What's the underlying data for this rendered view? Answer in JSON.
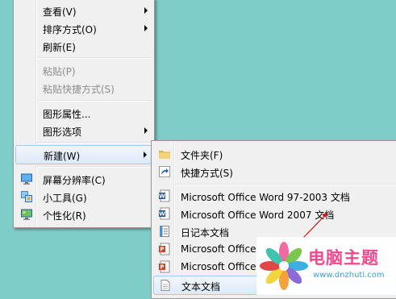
{
  "context_menu": {
    "items": [
      {
        "label": "查看(V)"
      },
      {
        "label": "排序方式(O)"
      },
      {
        "label": "刷新(E)"
      },
      {
        "label": "粘贴(P)"
      },
      {
        "label": "粘贴快捷方式(S)"
      },
      {
        "label": "图形属性..."
      },
      {
        "label": "图形选项"
      },
      {
        "label": "新建(W)"
      },
      {
        "label": "屏幕分辨率(C)"
      },
      {
        "label": "小工具(G)"
      },
      {
        "label": "个性化(R)"
      }
    ]
  },
  "new_submenu": {
    "items": [
      {
        "label": "文件夹(F)",
        "icon": "folder-icon"
      },
      {
        "label": "快捷方式(S)",
        "icon": "shortcut-icon"
      },
      {
        "label": "Microsoft Office Word 97-2003 文档",
        "icon": "word-97-2003-icon"
      },
      {
        "label": "Microsoft Office Word 2007 文档",
        "icon": "word-2007-icon"
      },
      {
        "label": "日记本文档",
        "icon": "journal-icon"
      },
      {
        "label": "Microsoft Office",
        "icon": "powerpoint-icon"
      },
      {
        "label": "Microsoft Office",
        "icon": "powerpoint-icon"
      },
      {
        "label": "文本文档",
        "icon": "text-document-icon"
      }
    ]
  },
  "watermark": {
    "title": "电脑主题",
    "url": "www.dnzhuti.com"
  },
  "colors": {
    "desktop": "#7ecdc8",
    "menu_bg": "#f0f0f0",
    "highlight_border": "#a9c9ec",
    "annotation_arrow": "#d01818",
    "watermark_title": "#ef4a8d",
    "watermark_url": "#3da3d6"
  }
}
